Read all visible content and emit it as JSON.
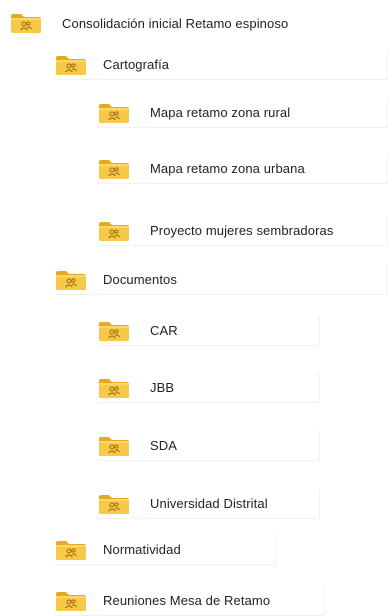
{
  "colors": {
    "folder_body": "#F7C948",
    "folder_back": "#E8A820",
    "folder_glyph": "#9A6B12",
    "divider": "#F1F1F1"
  },
  "icon": "shared-folder-icon",
  "root": {
    "label": "Consolidación inicial Retamo espinoso",
    "children": [
      {
        "label": "Cartografía",
        "children": [
          {
            "label": "Mapa retamo zona rural"
          },
          {
            "label": "Mapa retamo zona urbana"
          },
          {
            "label": "Proyecto mujeres sembradoras"
          }
        ]
      },
      {
        "label": "Documentos",
        "children": [
          {
            "label": "CAR"
          },
          {
            "label": "JBB"
          },
          {
            "label": "SDA"
          },
          {
            "label": "Universidad Distrital"
          }
        ]
      },
      {
        "label": "Normatividad"
      },
      {
        "label": "Reuniones Mesa de Retamo"
      }
    ]
  }
}
